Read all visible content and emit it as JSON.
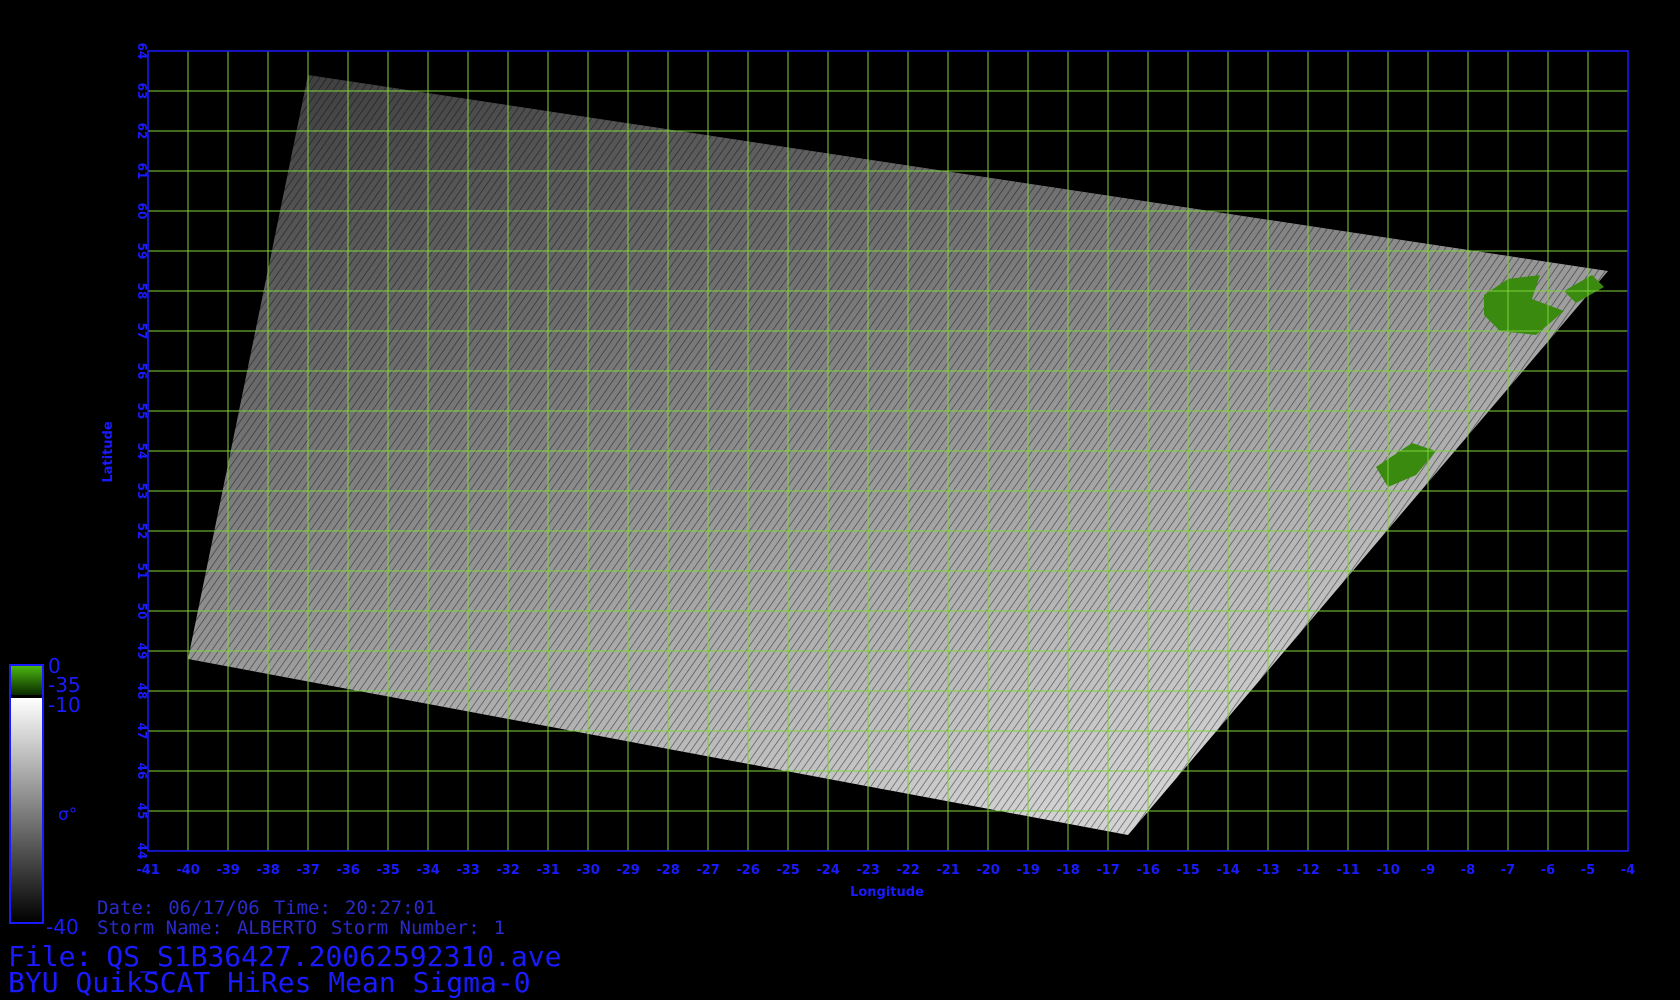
{
  "plot": {
    "xlabel": "Longitude",
    "ylabel": "Latitude",
    "lon_range": [
      -41,
      -4
    ],
    "lat_range": [
      44,
      64
    ],
    "lon_ticks": [
      -41,
      -40,
      -39,
      -38,
      -37,
      -36,
      -35,
      -34,
      -33,
      -32,
      -31,
      -30,
      -29,
      -28,
      -27,
      -26,
      -25,
      -24,
      -23,
      -22,
      -21,
      -20,
      -19,
      -18,
      -17,
      -16,
      -15,
      -14,
      -13,
      -12,
      -11,
      -10,
      -9,
      -8,
      -7,
      -6,
      -5,
      -4
    ],
    "lat_ticks": [
      44,
      45,
      46,
      47,
      48,
      49,
      50,
      51,
      52,
      53,
      54,
      55,
      56,
      57,
      58,
      59,
      60,
      61,
      62,
      63,
      64
    ],
    "grid": true,
    "colors": {
      "axis": "#1a1aff",
      "grid": "#7fd33a",
      "land": "#3a8a10",
      "background": "#000000"
    },
    "swath_corners_lonlat": [
      [
        -37,
        63.4
      ],
      [
        -4.5,
        58.5
      ],
      [
        -16.5,
        44.4
      ],
      [
        -40,
        48.8
      ]
    ]
  },
  "colorbar": {
    "label": "σ°",
    "land_top": "0",
    "land_bottom": "-35",
    "ocean_top": "-10",
    "ocean_bottom": "-40"
  },
  "info": {
    "date_label": "Date:",
    "date": "06/17/06",
    "time_label": "Time:",
    "time": "20:27:01",
    "storm_name_label": "Storm Name:",
    "storm_name": "ALBERTO",
    "storm_number_label": "Storm Number:",
    "storm_number": "1",
    "file_label": "File:",
    "file": "QS_S1B36427.20062592310.ave",
    "product": "BYU QuikSCAT HiRes Mean Sigma-0"
  }
}
